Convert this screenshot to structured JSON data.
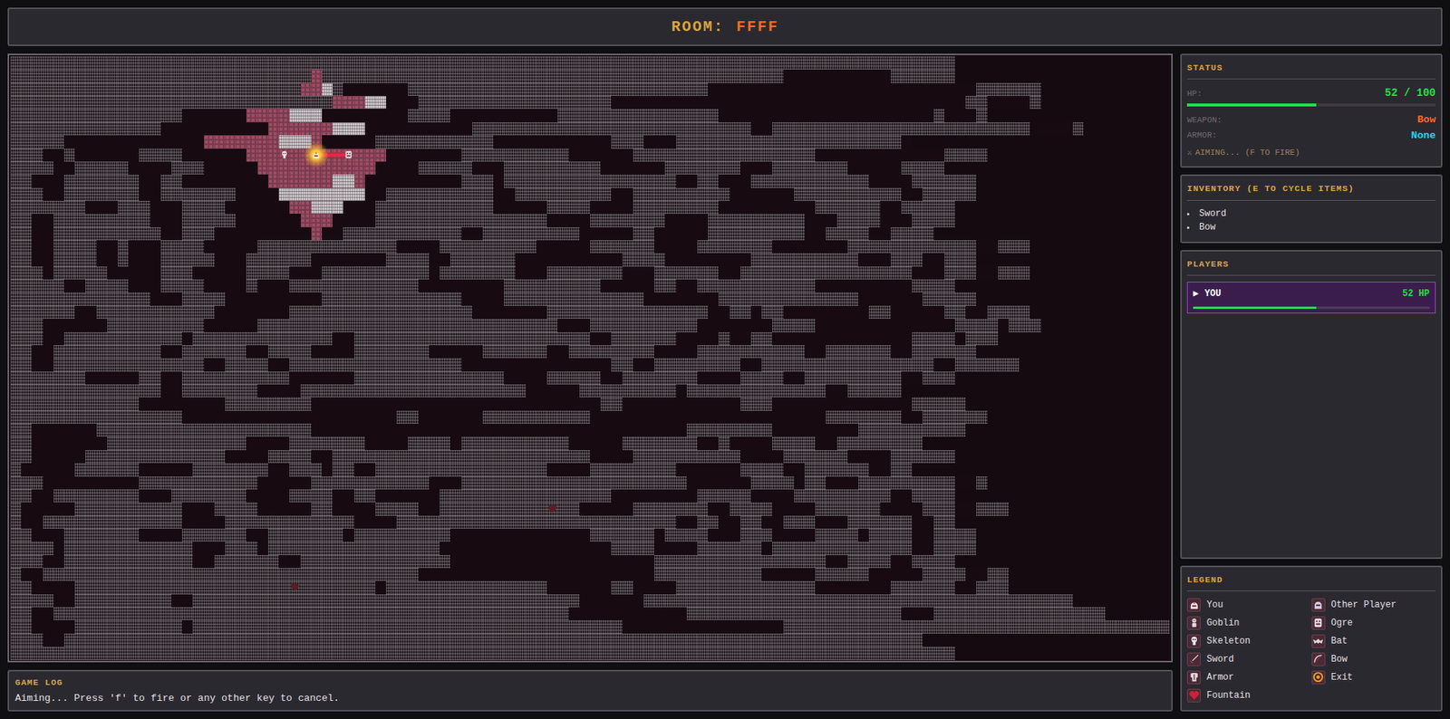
{
  "header": {
    "label": "ROOM:",
    "value": "FFFF"
  },
  "map": {
    "rows": [
      "########################################################################################",
      "############################f###########################################..........######",
      "###########################ffw#......############################.........................######",
      "##############################fffww...##################.................................##....#",
      "################......ffffwww........####..........###############....................#...#",
      "##############..........ffffffwww..........##########################..########################....#",
      "#####.............fffffffwwwf.....###########...........###...#####################.",
      "###..#......####......fffffffffffff.......##########......#################............####",
      "####..#####....###.....fffffffffff....#####...#########......#######...#######.....####",
      "##...#######..##........ffffffwwf.........###.################..##...###########....######",
      "###..#######..#######....wwwwwwww..##########..#########..#########......##########..#####",
      "#######...###...####......ffwww...###########.....####....########.........######..#####",
      "##..#########...#####......fff....################....#######....#########...####...####",
      "##..##########..###.........f..###########..#########.....##.....#########..####..####",
      "##..####..#...####.....#############....#########.....######....#######.......############..###",
      "##..####..#...#####...######.......####..######..........####........##########...###..###",
      "###.#####.....###.....####...##########.#######...#######...######..################...###..###",
      "#####..####...####....#...############........#########.....##..###########.........####",
      "#############...####.........#############....#############.......#############......#####",
      "######..###########.......#################.......###############..##.##........##.....##..####",
      "###......#########.....############################...##########.......####.............####.###",
      "###..###########.#############..######################..######....#..##.............####.###",
      "##..##########..######..####....#######.....######..########....##########..######..######",
      "##..##############..####..################..............##..########..################..######",
      "#######.....##..##########......##############....#####..#######....####..#########..###",
      "##############..#######....#####################.....#########.#############..#####",
      "############........########...........................##...........###.............#####",
      "################....................##......##########......................#######..######",
      "##......####################...................................########........##########",
      "##.......#############....#######....####.##########.....#######..#....####..########",
      "##.....#############....####..########################....##########....######....######",
      "#.....######.....#######..###.##..################....########......####..######..##",
      "###.........###########.....###########...#####################......####.##...#########..#",
      "##..########...#######....####..##......################........#####....#########..####",
      "#.....##########...####.....##....####..#############.....#######..####....######....###..###",
      "#..#############....############....##########################..##..##..###...######..##",
      "##...#######....######..#######.#########.............######.####...###....####.####..####",
      "####.############...###.################................####....######.#############..####",
      "###..############..######..##############...................################..####..####",
      "#..###################################......................##########.....#####.....####..##",
      "##....############################.###############......##....#############.......######..###",
      "####..#########..####################################......########################################",
      "##..################################################...........####################...################",
      "##....##########.########################################...............####################################",
      "###..################################################################################",
      "########################################################################################"
    ],
    "entities": [
      {
        "kind": "skeleton",
        "row": 7,
        "col": 25
      },
      {
        "kind": "player",
        "row": 7,
        "col": 28
      },
      {
        "kind": "ogre",
        "row": 7,
        "col": 31
      },
      {
        "kind": "fountain",
        "row": 34,
        "col": 50
      },
      {
        "kind": "fountain",
        "row": 40,
        "col": 26
      }
    ],
    "aim": {
      "active": true,
      "row": 7,
      "from_col": 28,
      "to_col": 31
    }
  },
  "status": {
    "title": "STATUS",
    "hp": {
      "label": "HP:",
      "value": "52 / 100",
      "level": 0.52
    },
    "weapon": {
      "label": "WEAPON:",
      "value": "Bow"
    },
    "armor": {
      "label": "ARMOR:",
      "value": "None"
    },
    "mode": {
      "icon": "⚔",
      "text": "AIMING... (F TO FIRE)"
    }
  },
  "inventory": {
    "title": "INVENTORY (E TO CYCLE ITEMS)",
    "items": [
      "Sword",
      "Bow"
    ]
  },
  "players": {
    "title": "PLAYERS",
    "list": [
      {
        "marker": "▶",
        "name": "YOU",
        "hp": "52 HP",
        "level": 0.52,
        "selected": true
      }
    ]
  },
  "legend": {
    "title": "LEGEND",
    "items": [
      {
        "kind": "you",
        "label": "You"
      },
      {
        "kind": "other_player",
        "label": "Other Player"
      },
      {
        "kind": "goblin",
        "label": "Goblin"
      },
      {
        "kind": "ogre",
        "label": "Ogre"
      },
      {
        "kind": "skeleton",
        "label": "Skeleton"
      },
      {
        "kind": "bat",
        "label": "Bat"
      },
      {
        "kind": "sword",
        "label": "Sword"
      },
      {
        "kind": "bow",
        "label": "Bow"
      },
      {
        "kind": "armor",
        "label": "Armor"
      },
      {
        "kind": "exit",
        "label": "Exit"
      },
      {
        "kind": "fountain",
        "label": "Fountain"
      }
    ]
  },
  "log": {
    "title": "GAME LOG",
    "messages": [
      "Aiming... Press 'f' to fire or any other key to cancel."
    ]
  }
}
